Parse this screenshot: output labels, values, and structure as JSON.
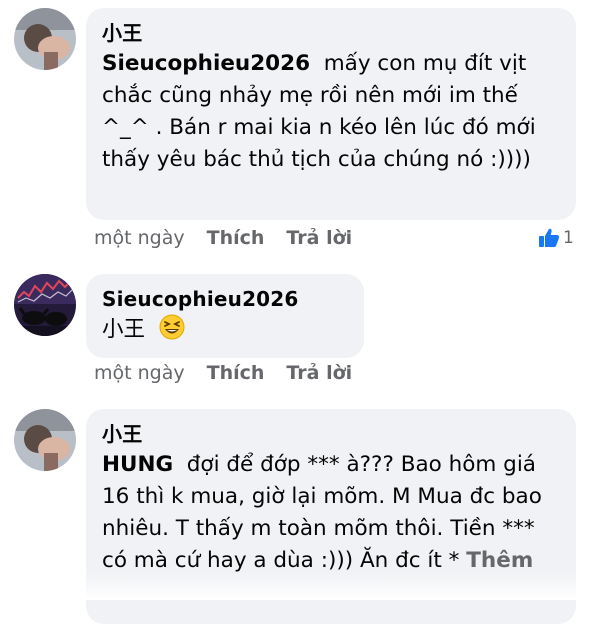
{
  "comments": [
    {
      "author": "小王",
      "mention": "Sieucophieu2026",
      "text": "mấy con mụ đít vịt chắc cũng nhảy mẹ rồi nên mới im thế ^_^ . Bán r mai kia n kéo lên lúc đó mới thấy yêu bác thủ tịch của chúng nó :))))",
      "time": "một ngày",
      "like_label": "Thích",
      "reply_label": "Trả lời",
      "reaction_count": "1",
      "avatar_icon": "person-photo-avatar"
    },
    {
      "author": "Sieucophieu2026",
      "mention": "小王",
      "text": "",
      "emoji_icon": "grinning-squinting-face-emoji",
      "time": "một ngày",
      "like_label": "Thích",
      "reply_label": "Trả lời",
      "avatar_icon": "stock-chart-bull-bear-avatar"
    },
    {
      "author": "小王",
      "mention": "HUNG",
      "text": "đợi để đớp *** à??? Bao hôm giá 16 thì k mua, giờ lại mõm. M Mua đc bao nhiêu. T thấy m toàn mõm thôi. Tiền *** có mà cứ hay a dùa :)))",
      "text_tail": "Ăn đc ít *",
      "more_label": "Thêm",
      "avatar_icon": "person-photo-avatar"
    }
  ],
  "colors": {
    "bubble": "#f0f2f5",
    "meta_text": "#65676b",
    "like_blue": "#1877f2"
  }
}
